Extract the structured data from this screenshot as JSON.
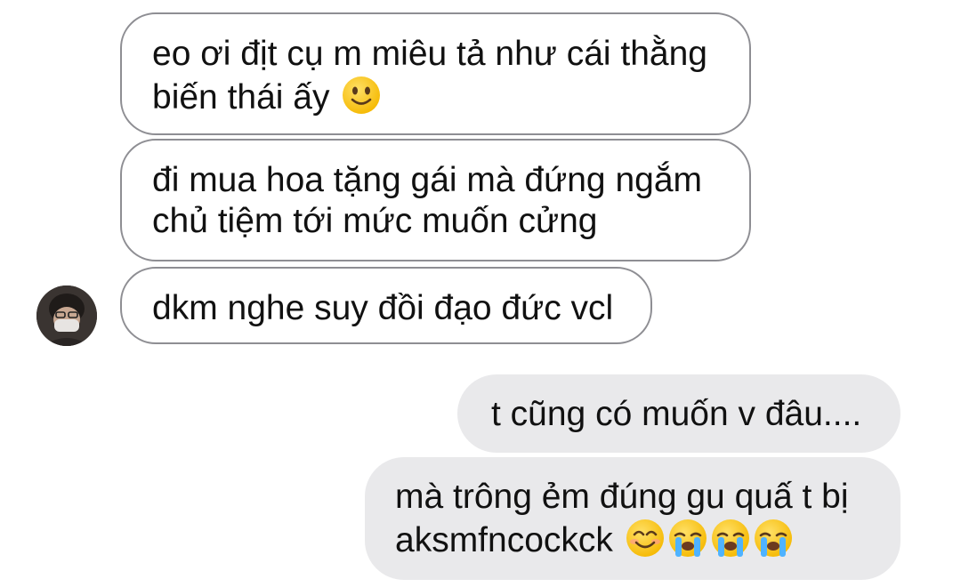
{
  "conversation": {
    "incoming": [
      {
        "lines": [
          "eo ơi địt cụ m miêu tả như cái thằng",
          "biến thái ấy"
        ],
        "emoji": "slightly-smiling-face-icon"
      },
      {
        "lines": [
          "đi mua hoa tặng gái mà đứng ngắm",
          "chủ tiệm tới mức muốn cửng"
        ]
      },
      {
        "lines": [
          "dkm nghe suy đồi đạo đức vcl"
        ]
      }
    ],
    "outgoing": [
      {
        "lines": [
          "t cũng có muốn v đâu...."
        ]
      },
      {
        "lines": [
          "mà trông ẻm đúng gu quấ t bị",
          "aksmfncockck"
        ],
        "emojis": [
          "smiling-face-with-smiling-eyes-icon",
          "loudly-crying-face-icon",
          "loudly-crying-face-icon",
          "loudly-crying-face-icon"
        ]
      }
    ],
    "avatar": "contact-avatar"
  },
  "colors": {
    "incoming_border": "#8e8e93",
    "incoming_bg": "#ffffff",
    "outgoing_bg": "#e9e9eb",
    "text": "#111111",
    "emoji_yellow": "#ffcc33"
  }
}
